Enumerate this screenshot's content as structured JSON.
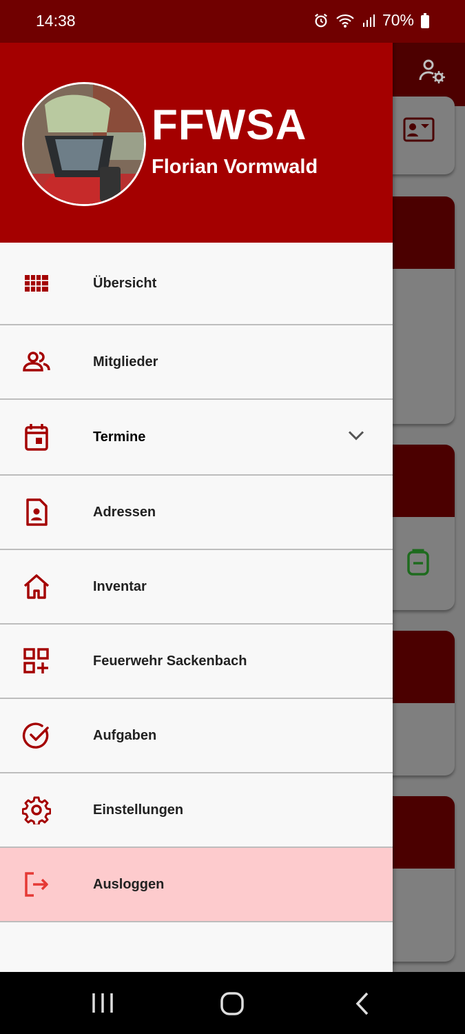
{
  "status_bar": {
    "time": "14:38",
    "battery": "70%",
    "icons": [
      "alarm-icon",
      "wifi-icon",
      "signal-icon",
      "battery-icon"
    ]
  },
  "drawer": {
    "header": {
      "org_name": "FFWSA",
      "user_name": "Florian Vormwald"
    },
    "items": [
      {
        "label": "Übersicht",
        "icon": "grid-icon"
      },
      {
        "label": "Mitglieder",
        "icon": "people-icon"
      },
      {
        "label": "Termine",
        "icon": "calendar-icon",
        "expandable": true
      },
      {
        "label": "Adressen",
        "icon": "contact-file-icon"
      },
      {
        "label": "Inventar",
        "icon": "home-icon"
      },
      {
        "label": "Feuerwehr Sackenbach",
        "icon": "add-widget-icon"
      },
      {
        "label": "Aufgaben",
        "icon": "check-circle-icon"
      },
      {
        "label": "Einstellungen",
        "icon": "gear-icon"
      },
      {
        "label": "Ausloggen",
        "icon": "logout-icon"
      }
    ]
  },
  "colors": {
    "primary": "#a40000",
    "status_bar": "#700000",
    "logout_bg": "#fdcbcd",
    "icon": "#a40000",
    "logout_icon": "#e53935"
  }
}
